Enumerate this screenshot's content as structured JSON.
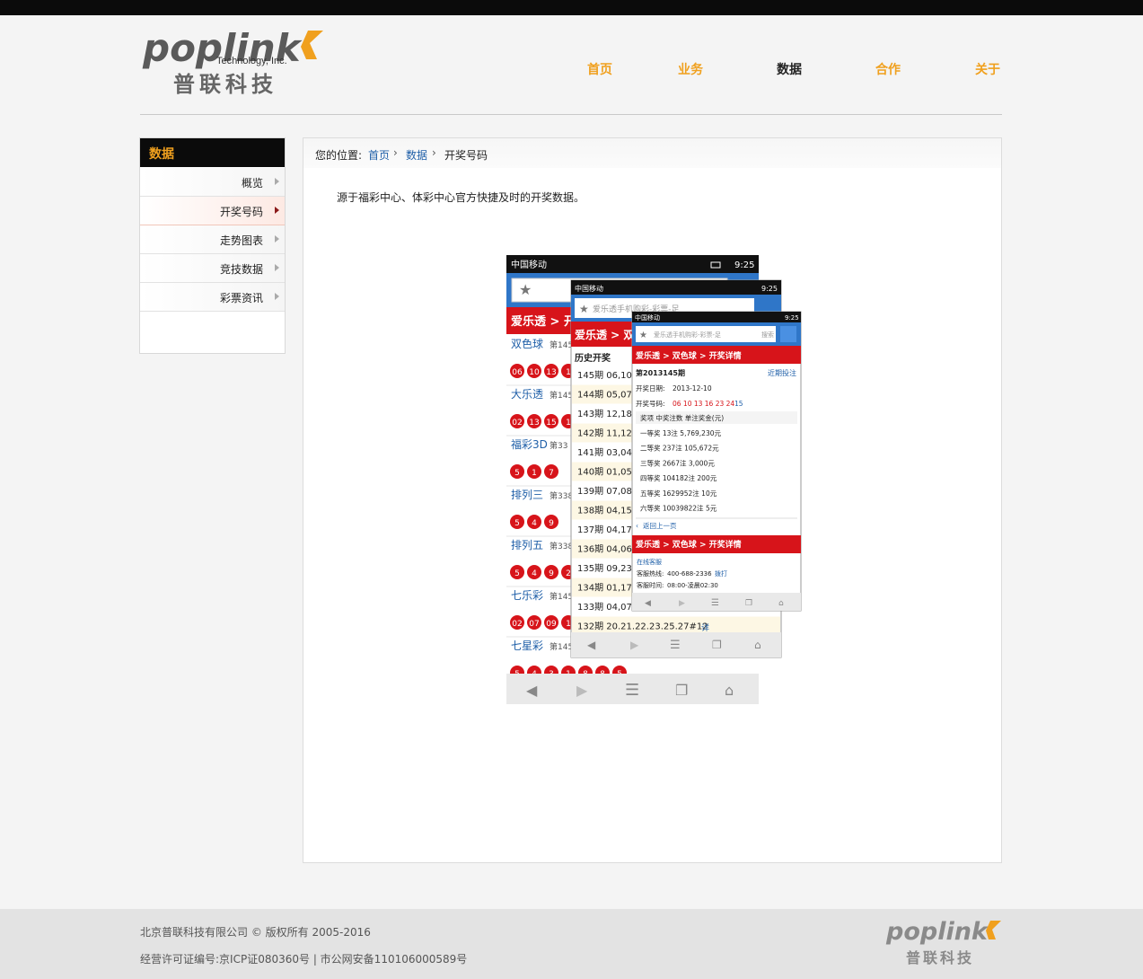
{
  "logo": {
    "brand": "poplink",
    "tagline": "Technology, Inc.",
    "cn": "普联科技"
  },
  "nav": [
    "首页",
    "业务",
    "数据",
    "合作",
    "关于"
  ],
  "sidebar": {
    "title": "数据",
    "items": [
      "概览",
      "开奖号码",
      "走势图表",
      "竞技数据",
      "彩票资讯"
    ]
  },
  "breadcrumb": {
    "prefix": "您的位置:",
    "home": "首页",
    "section": "数据",
    "current": "开奖号码"
  },
  "description": "源于福彩中心、体彩中心官方快捷及时的开奖数据。",
  "screens": {
    "status_carrier": "中国移动",
    "status_time": "9:25",
    "search": "爱乐透手机购彩-彩票-足",
    "search_placeholder": "搜索",
    "s1": {
      "header": "爱乐透 > 开",
      "lotteries": [
        {
          "name": "双色球",
          "issue": "第145",
          "balls": [
            "06",
            "10",
            "13",
            "1"
          ]
        },
        {
          "name": "大乐透",
          "issue": "第145",
          "balls": [
            "02",
            "13",
            "15",
            "1"
          ]
        },
        {
          "name": "福彩3D",
          "issue": "第33",
          "balls": [
            "5",
            "1",
            "7"
          ]
        },
        {
          "name": "排列三",
          "issue": "第338",
          "balls": [
            "5",
            "4",
            "9"
          ]
        },
        {
          "name": "排列五",
          "issue": "第338",
          "balls": [
            "5",
            "4",
            "9",
            "2"
          ]
        },
        {
          "name": "七乐彩",
          "issue": "第145",
          "balls": [
            "02",
            "07",
            "09",
            "1"
          ]
        },
        {
          "name": "七星彩",
          "issue": "第145",
          "balls": [
            "5",
            "4",
            "3",
            "1",
            "8",
            "8",
            "5"
          ]
        }
      ]
    },
    "s2": {
      "header": "爱乐透 > 双",
      "section": "历史开奖",
      "rows": [
        "145期 06,10,",
        "144期 05,07,",
        "143期 12,18,",
        "142期 11,12,",
        "141期 03,04,",
        "140期 01,05,",
        "139期 07,08,",
        "138期 04,15,",
        "137期 04,17,",
        "136期 04,06,",
        "135期 09,23,",
        "134期 01,17,",
        "133期 04,07,",
        "132期 20.21.22.23.25.27#12"
      ],
      "detail_link": "详"
    },
    "s3": {
      "header": "爱乐透 > 双色球 > 开奖详情",
      "issue": "第2013145期",
      "more": "近期投注",
      "date_label": "开奖日期:",
      "date": "2013-12-10",
      "numbers_label": "开奖号码:",
      "red": "06 10 13 16 23 24",
      "blue": "15",
      "prize_header": "奖项 中奖注数 单注奖金(元)",
      "prizes": [
        "一等奖 13注 5,769,230元",
        "二等奖 237注 105,672元",
        "三等奖 2667注 3,000元",
        "四等奖 104182注 200元",
        "五等奖 1629952注 10元",
        "六等奖 10039822注 5元"
      ],
      "back": "返回上一页",
      "header2": "爱乐透 > 双色球 > 开奖详情",
      "service": "在线客服",
      "hotline_label": "客服热线:",
      "hotline": "400-688-2336",
      "dial": "拨打",
      "hours_label": "客服时间:",
      "hours": "08:00-凌晨02:30"
    }
  },
  "footer": {
    "line1": "北京普联科技有限公司 © 版权所有 2005-2016",
    "line2": "经营许可证编号:京ICP证080360号 | 市公网安备110106000589号"
  },
  "colors": {
    "accent": "#f0a01e",
    "dark": "#0b0b0b",
    "red": "#d7141a",
    "link": "#1f5fa8"
  }
}
